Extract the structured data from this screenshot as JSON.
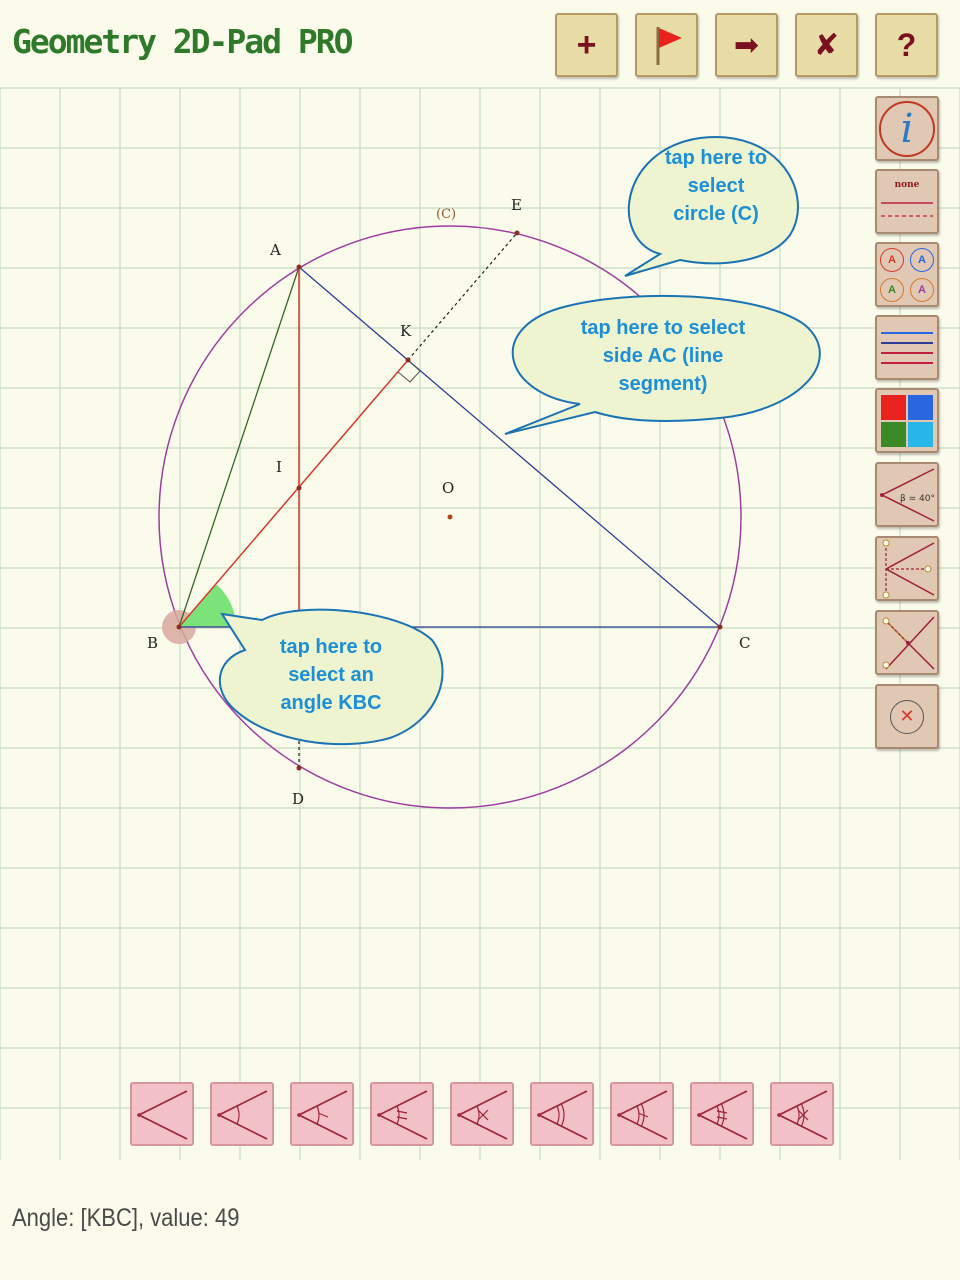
{
  "app": {
    "title": "Geometry 2D-Pad PRO"
  },
  "toolbar": {
    "buttons": [
      {
        "name": "add",
        "glyph": "+"
      },
      {
        "name": "flag",
        "glyph": ""
      },
      {
        "name": "redo",
        "glyph": "➡"
      },
      {
        "name": "close",
        "glyph": "✘"
      },
      {
        "name": "help",
        "glyph": "?"
      }
    ]
  },
  "sidebar": {
    "info_glyph": "i",
    "line_style_label": "none",
    "font_letters": [
      "A",
      "A",
      "A",
      "A"
    ],
    "angle_tool_label": "β = 40°",
    "colors": [
      "#e8231e",
      "#2a66e0",
      "#3a8a28",
      "#28b6e8"
    ]
  },
  "canvas": {
    "points": {
      "A": "A",
      "B": "B",
      "C": "C",
      "D": "D",
      "E": "E",
      "K": "K",
      "I": "I",
      "O": "O"
    },
    "circle_label": "(C)"
  },
  "callouts": {
    "circle": "tap here to\nselect\ncircle (C)",
    "side": "tap here to select\nside AC (line\nsegment)",
    "angle": "tap here to\nselect an\nangle KBC"
  },
  "angle_marks": [
    "plain",
    "single-arc",
    "single-arc-tick",
    "single-arc-double-tick",
    "single-arc-cross",
    "double-arc",
    "double-arc-tick",
    "double-arc-double-tick",
    "double-arc-cross"
  ],
  "status": {
    "text": "Angle: [KBC], value: 49"
  },
  "colors": {
    "background": "#fbfbeb",
    "grid": "#c6dbc2",
    "circle": "#a03da0",
    "segment_red": "#d83a2a",
    "segment_blue": "#2e3c98",
    "segment_green": "#2e6a1e",
    "angle_fill": "#7ce37a",
    "callout_fill": "#eef4cf",
    "callout_stroke": "#1b73b3"
  }
}
